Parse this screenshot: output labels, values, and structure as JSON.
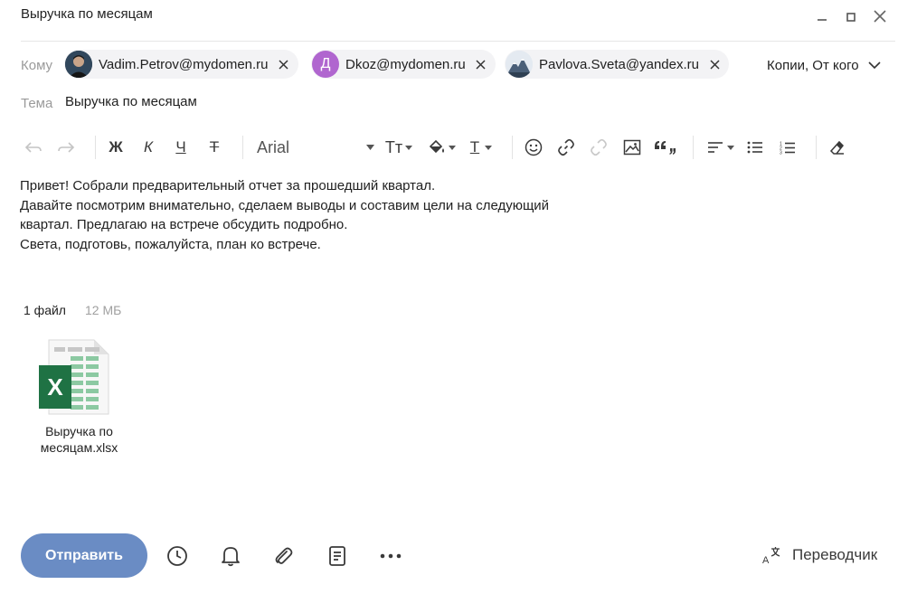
{
  "window": {
    "title": "Выручка по месяцам"
  },
  "compose": {
    "to_label": "Кому",
    "recipients": [
      {
        "email": "Vadim.Petrov@mydomen.ru",
        "avatar": "photo"
      },
      {
        "email": "Dkoz@mydomen.ru",
        "avatar": "letter",
        "initial": "Д",
        "avatar_color": "#b066cf"
      },
      {
        "email": "Pavlova.Sveta@yandex.ru",
        "avatar": "photo"
      }
    ],
    "copies_label": "Копии, От кого",
    "subject_label": "Тема",
    "subject_value": "Выручка по месяцам"
  },
  "toolbar": {
    "bold_label": "Ж",
    "italic_label": "К",
    "underline_label": "Ч",
    "strike_label": "Т",
    "font_name": "Arial",
    "text_size_label": "Тт",
    "text_color_label": "Т"
  },
  "body": {
    "lines": [
      "Привет! Собрали предварительный отчет за прошедший квартал.",
      "Давайте посмотрим внимательно, сделаем выводы и составим цели на следующий",
      "квартал. Предлагаю на встрече обсудить подробно.",
      "Света, подготовь, пожалуйста, план ко встрече."
    ]
  },
  "attachments": {
    "count_label": "1 файл",
    "size_label": "12 МБ",
    "file": {
      "name_line1": "Выручка по",
      "name_line2": "месяцам.xlsx",
      "badge": "X"
    }
  },
  "footer": {
    "send_label": "Отправить",
    "translator_label": "Переводчик"
  },
  "colors": {
    "send_button": "#6a8cc4",
    "excel_green": "#1f7244",
    "chip_bg": "#f3f3f5"
  }
}
